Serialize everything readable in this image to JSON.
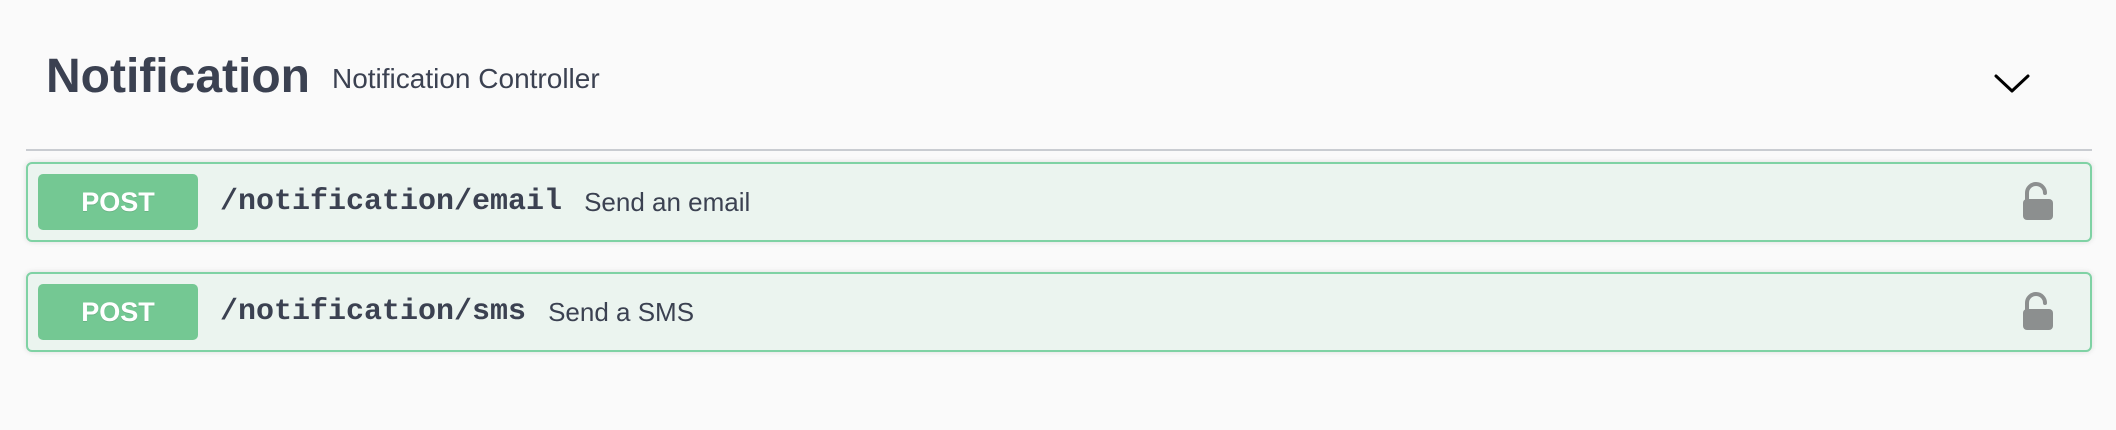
{
  "tag": {
    "name": "Notification",
    "description": "Notification Controller",
    "expand_icon": "chevron-down-icon"
  },
  "operations": [
    {
      "method": "POST",
      "path": "/notification/email",
      "summary": "Send an email",
      "lock_icon": "unlocked-padlock-icon"
    },
    {
      "method": "POST",
      "path": "/notification/sms",
      "summary": "Send a SMS",
      "lock_icon": "unlocked-padlock-icon"
    }
  ],
  "colors": {
    "post_bg": "#ebf4ef",
    "post_border": "#7fd2a4",
    "post_method": "#74c893",
    "text": "#3b4151"
  }
}
